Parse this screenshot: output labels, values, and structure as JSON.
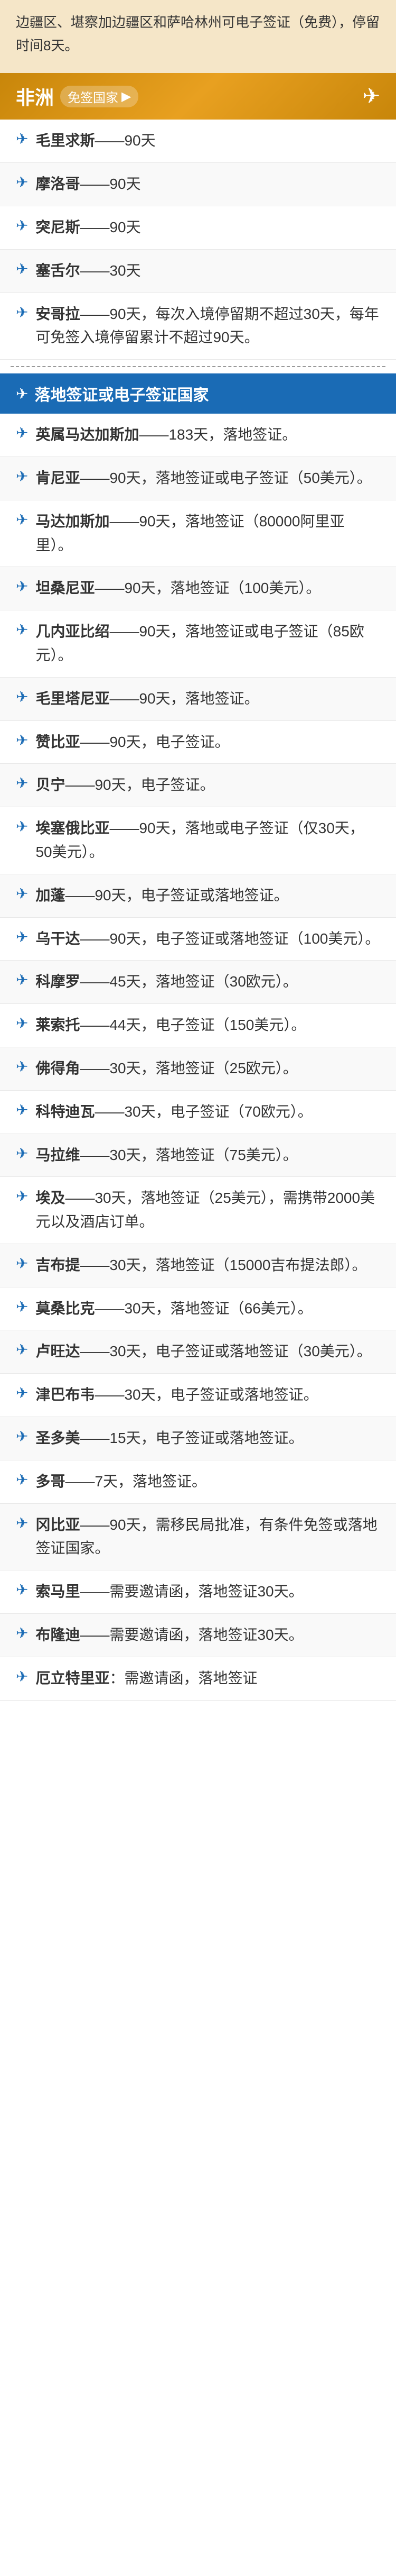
{
  "top": {
    "text": "边疆区、堪察加边疆区和萨哈林州可电子签证（免费），停留时间8天。"
  },
  "africa": {
    "title": "非洲",
    "subtitle": "免签国家",
    "arrow": "▶",
    "freeVisa": [
      {
        "country": "毛里求斯",
        "duration": "90天"
      },
      {
        "country": "摩洛哥",
        "duration": "90天"
      },
      {
        "country": "突尼斯",
        "duration": "90天"
      },
      {
        "country": "塞舌尔",
        "duration": "30天"
      },
      {
        "country": "安哥拉",
        "detail": "90天，每次入境停留期不超过30天，每年可免签入境停留累计不超过90天。"
      }
    ],
    "sectionTitle": "落地签证或电子签证国家",
    "landingVisa": [
      {
        "country": "英属马达加斯加",
        "detail": "183天，落地签证。"
      },
      {
        "country": "肯尼亚",
        "detail": "90天，落地签证或电子签证（50美元）。"
      },
      {
        "country": "马达加斯加",
        "detail": "90天，落地签证（80000阿里亚里）。"
      },
      {
        "country": "坦桑尼亚",
        "detail": "90天，落地签证（100美元）。"
      },
      {
        "country": "几内亚比绍",
        "detail": "90天，落地签证或电子签证（85欧元）。"
      },
      {
        "country": "毛里塔尼亚",
        "detail": "90天，落地签证。"
      },
      {
        "country": "赞比亚",
        "detail": "90天，电子签证。"
      },
      {
        "country": "贝宁",
        "detail": "90天，电子签证。"
      },
      {
        "country": "埃塞俄比亚",
        "detail": "90天，落地或电子签证（仅30天，50美元）。"
      },
      {
        "country": "加蓬",
        "detail": "90天，电子签证或落地签证。"
      },
      {
        "country": "乌干达",
        "detail": "90天，电子签证或落地签证（100美元）。"
      },
      {
        "country": "科摩罗",
        "detail": "45天，落地签证（30欧元）。"
      },
      {
        "country": "莱索托",
        "detail": "44天，电子签证（150美元）。"
      },
      {
        "country": "佛得角",
        "detail": "30天，落地签证（25欧元）。"
      },
      {
        "country": "科特迪瓦",
        "detail": "30天，电子签证（70欧元）。"
      },
      {
        "country": "马拉维",
        "detail": "30天，落地签证（75美元）。"
      },
      {
        "country": "埃及",
        "detail": "30天，落地签证（25美元），需携带2000美元以及酒店订单。"
      },
      {
        "country": "吉布提",
        "detail": "30天，落地签证（15000吉布提法郎）。"
      },
      {
        "country": "莫桑比克",
        "detail": "30天，落地签证（66美元）。"
      },
      {
        "country": "卢旺达",
        "detail": "30天，电子签证或落地签证（30美元）。"
      },
      {
        "country": "津巴布韦",
        "detail": "30天，电子签证或落地签证。"
      },
      {
        "country": "圣多美",
        "detail": "15天，电子签证或落地签证。"
      },
      {
        "country": "多哥",
        "detail": "7天，落地签证。"
      },
      {
        "country": "冈比亚",
        "detail": "90天，需移民局批准，有条件免签或落地签证国家。"
      },
      {
        "country": "索马里",
        "detail": "需要邀请函，落地签证30天。"
      },
      {
        "country": "布隆迪",
        "detail": "需要邀请函，落地签证30天。"
      },
      {
        "country": "厄立特里亚",
        "detail": "需邀请函，落地签证"
      }
    ]
  }
}
